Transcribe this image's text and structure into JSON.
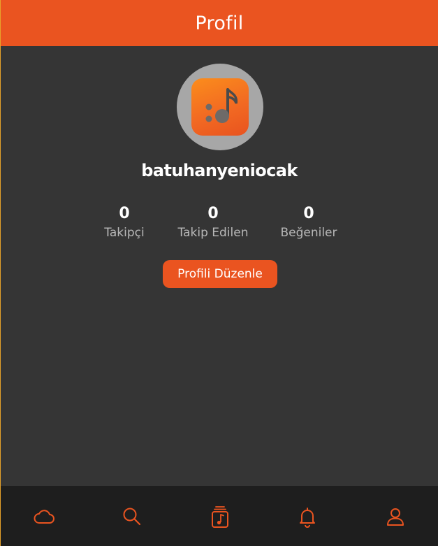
{
  "header": {
    "title": "Profil"
  },
  "profile": {
    "avatar_icon": "music-note-app-icon",
    "username": "batuhanyeniocak"
  },
  "stats": [
    {
      "value": "0",
      "label": "Takipçi"
    },
    {
      "value": "0",
      "label": "Takip Edilen"
    },
    {
      "value": "0",
      "label": "Beğeniler"
    }
  ],
  "edit_button": {
    "label": "Profili Düzenle"
  },
  "bottom_nav": {
    "items": [
      {
        "icon": "cloud-icon"
      },
      {
        "icon": "search-icon"
      },
      {
        "icon": "music-library-icon"
      },
      {
        "icon": "bell-icon"
      },
      {
        "icon": "user-icon"
      }
    ]
  },
  "colors": {
    "accent": "#ea5420",
    "background": "#353535",
    "nav_background": "#1e1e1e",
    "avatar_ring": "#a7a7a7",
    "muted_text": "#b8b8b8"
  }
}
